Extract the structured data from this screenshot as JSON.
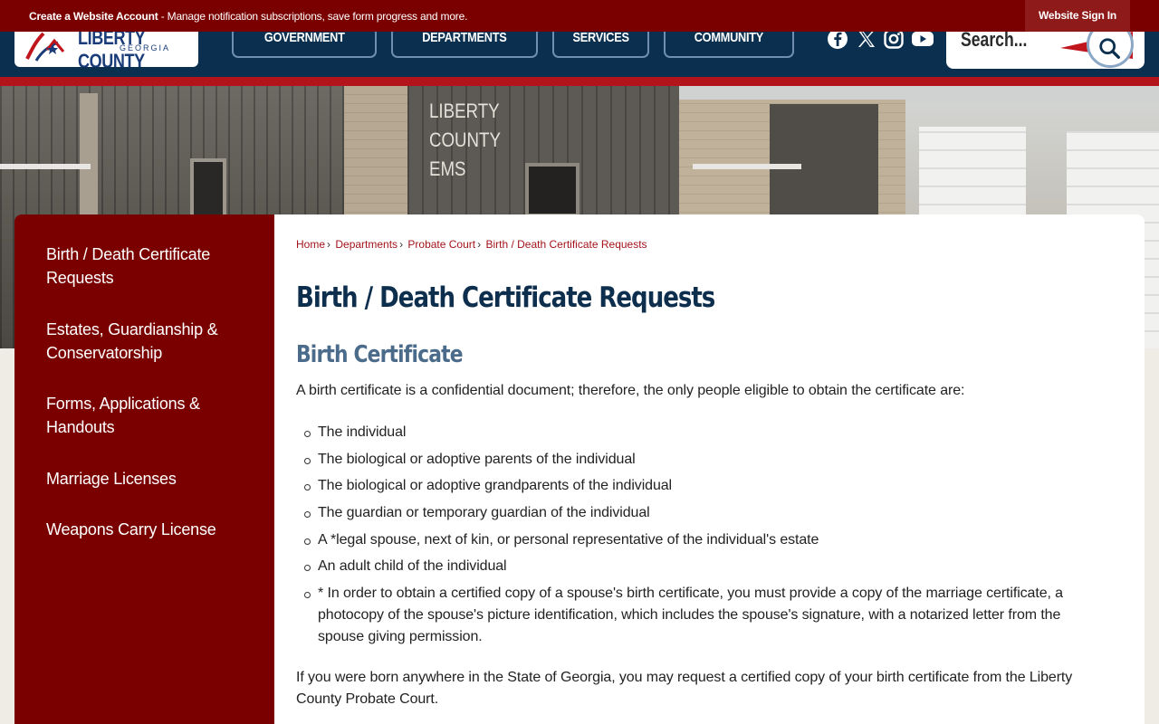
{
  "topbar": {
    "create_account_label": "Create a Website Account",
    "message": " - Manage notification subscriptions, save form progress and more.",
    "signin_label": "Website Sign In"
  },
  "header": {
    "logo_name": "LIBERTY COUNTY",
    "logo_state": "GEORGIA",
    "nav": [
      "GOVERNMENT",
      "DEPARTMENTS",
      "SERVICES",
      "COMMUNITY"
    ],
    "social_icons": [
      "facebook-icon",
      "x-icon",
      "instagram-icon",
      "youtube-icon"
    ],
    "search_placeholder": "Search..."
  },
  "hero": {
    "sign_lines": [
      "LIBERTY",
      "COUNTY",
      "EMS"
    ]
  },
  "sidebar": {
    "items": [
      {
        "label": "Birth / Death Certificate Requests"
      },
      {
        "label": "Estates, Guardianship & Conservatorship"
      },
      {
        "label": "Forms, Applications & Handouts"
      },
      {
        "label": "Marriage Licenses"
      },
      {
        "label": "Weapons Carry License"
      }
    ]
  },
  "breadcrumb": [
    "Home",
    "Departments",
    "Probate Court",
    "Birth / Death Certificate Requests"
  ],
  "main": {
    "title": "Birth / Death Certificate Requests",
    "section_title": "Birth Certificate",
    "intro": "A birth certificate is a confidential document; therefore, the only people eligible to obtain the certificate are:",
    "eligible": [
      "The individual",
      "The biological or adoptive parents of the individual",
      "The biological or adoptive grandparents of the individual",
      "The guardian or temporary guardian of the individual",
      "A *legal spouse, next of kin, or personal representative of the individual's estate",
      "An adult child of the individual",
      "* In order to obtain a certified copy of a spouse's birth certificate, you must provide a copy of the marriage certificate, a photocopy of the spouse's picture identification, which includes the spouse's signature, with a notarized letter from the spouse giving permission."
    ],
    "paragraph": "If you were born anywhere in the State of Georgia, you may request a certified copy of your birth certificate from the Liberty County Probate Court."
  },
  "colors": {
    "maroon": "#7a0000",
    "navy": "#0a2f4f",
    "accent_red": "#b3131b",
    "link": "#a3141b"
  }
}
